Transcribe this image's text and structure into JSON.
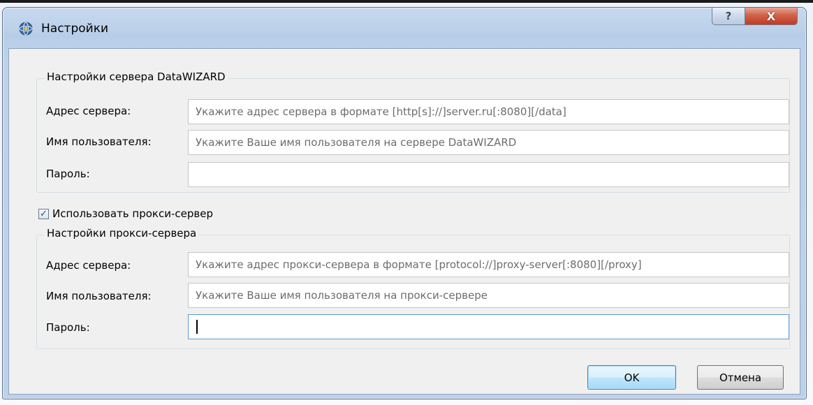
{
  "window": {
    "title": "Настройки",
    "help_symbol": "?",
    "close_symbol": "X"
  },
  "server_group": {
    "title": "Настройки сервера DataWIZARD",
    "address_label": "Адрес сервера:",
    "address_placeholder": "Укажите адрес сервера в формате [http[s]://]server.ru[:8080][/data]",
    "username_label": "Имя пользователя:",
    "username_placeholder": "Укажите Ваше имя пользователя на сервере DataWIZARD",
    "password_label": "Пароль:",
    "password_value": ""
  },
  "use_proxy": {
    "label": "Использовать прокси-сервер",
    "checked": true,
    "check_glyph": "✓"
  },
  "proxy_group": {
    "title": "Настройки прокси-сервера",
    "address_label": "Адрес сервера:",
    "address_placeholder": "Укажите адрес прокси-сервера в формате [protocol://]proxy-server[:8080][/proxy]",
    "username_label": "Имя пользователя:",
    "username_placeholder": "Укажите Ваше имя пользователя на прокси-сервере",
    "password_label": "Пароль:",
    "password_value": ""
  },
  "buttons": {
    "ok": "OK",
    "cancel": "Отмена"
  },
  "icons": {
    "app": "settings-app-icon",
    "help": "help-icon",
    "close": "close-icon"
  }
}
